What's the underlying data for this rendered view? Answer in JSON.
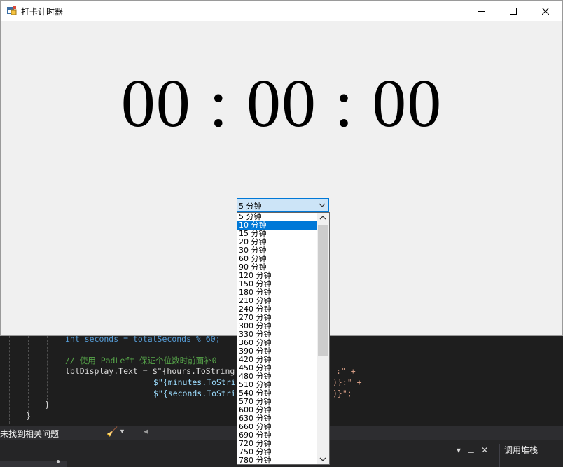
{
  "window": {
    "title": "打卡计时器",
    "controls": [
      "minimize",
      "maximize",
      "close"
    ]
  },
  "timer": {
    "display": "00 : 00 : 00"
  },
  "duration_select": {
    "selected": "5 分钟",
    "options": [
      "5 分钟",
      "10 分钟",
      "15 分钟",
      "20 分钟",
      "30 分钟",
      "60 分钟",
      "90 分钟",
      "120 分钟",
      "150 分钟",
      "180 分钟",
      "210 分钟",
      "240 分钟",
      "270 分钟",
      "300 分钟",
      "330 分钟",
      "360 分钟",
      "390 分钟",
      "420 分钟",
      "450 分钟",
      "480 分钟",
      "510 分钟",
      "540 分钟",
      "570 分钟",
      "600 分钟",
      "630 分钟",
      "660 分钟",
      "690 分钟",
      "720 分钟",
      "750 分钟",
      "780 分钟"
    ],
    "highlighted_index": 1
  },
  "ide": {
    "code_lines": {
      "line1": "int seconds = totalSeconds % 60;",
      "line2": "// 使用 PadLeft 保证个位数时前面补0",
      "line3a": "lblDisplay.Text = $\"{hours.ToString",
      "line3b": ":\" +",
      "line4a": "$\"{minutes.ToStri",
      "line4b": ")}:\" +",
      "line5a": "$\"{seconds.ToStri",
      "line5b": ")}\";",
      "brace1": "}",
      "brace2": "}"
    },
    "status_message": "未找到相关问题",
    "panel_title": "调用堆栈"
  },
  "colors": {
    "accent": "#0078d7",
    "combo_bg": "#cce4f7",
    "window_bg": "#f0f0f0",
    "ide_bg": "#1e1e1e"
  }
}
